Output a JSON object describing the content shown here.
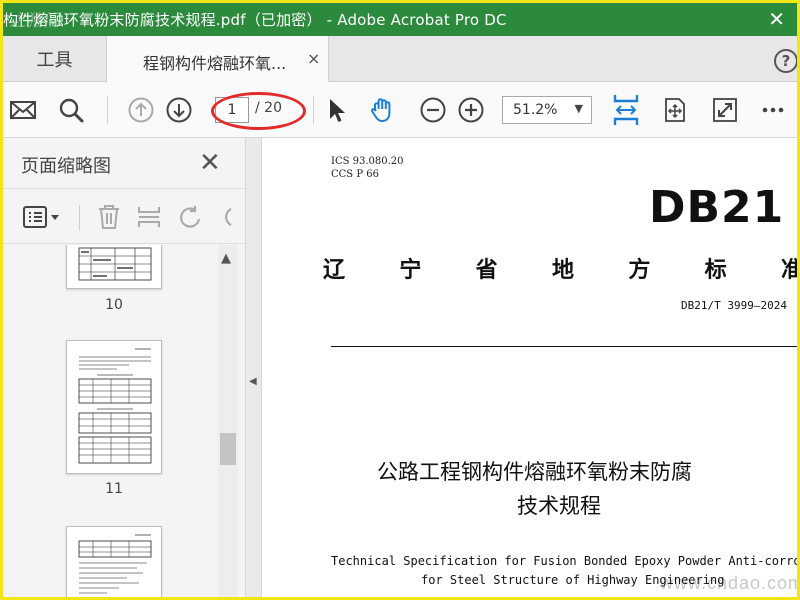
{
  "window": {
    "title": "构件熔融环氧粉末防腐技术规程.pdf（已加密） - Adobe Acrobat Pro DC",
    "corner_mark": "之猪问"
  },
  "tabs": {
    "tools_label": "工具",
    "doc_label": "程钢构件熔融环氧...",
    "close_glyph": "×"
  },
  "toolbar": {
    "page_current": "1",
    "page_total": "/ 20",
    "zoom": "51.2%"
  },
  "sidebar": {
    "title": "页面缩略图",
    "thumbnails": [
      {
        "label": "10"
      },
      {
        "label": "11"
      },
      {
        "label": ""
      }
    ]
  },
  "document": {
    "ics": "ICS  93.080.20",
    "ccs": "CCS  P 66",
    "logo": "DB21",
    "standard_chars": [
      "辽",
      "宁",
      "省",
      "地",
      "方",
      "标",
      "准"
    ],
    "code": "DB21/T 3999—2024",
    "title_line1": "公路工程钢构件熔融环氧粉末防腐",
    "title_line2": "技术规程",
    "english_line1": "Technical Specification for Fusion Bonded Epoxy Powder Anti-corrosion",
    "english_line2": "for Steel Structure of Highway Engineering"
  },
  "watermark": "www.cndao.com",
  "colors": {
    "titlebar": "#2c8a3c",
    "accent_blue": "#1a7fd6",
    "highlight_red": "#e32b2b",
    "frame_yellow": "#f3e617"
  }
}
